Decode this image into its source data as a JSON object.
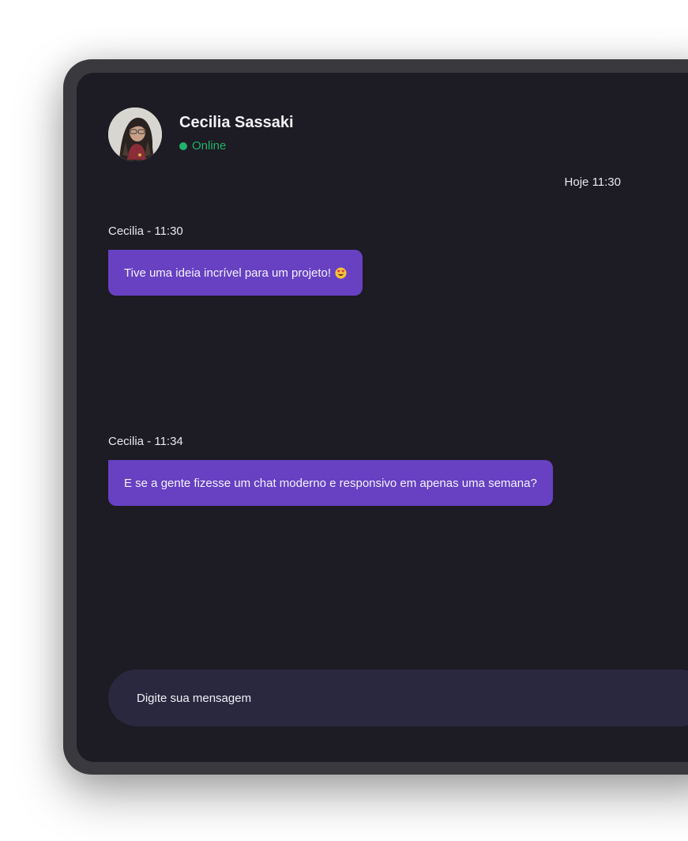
{
  "contact": {
    "name": "Cecilia Sassaki",
    "status": "Online",
    "avatar_icon": "user-avatar-photo"
  },
  "chat": {
    "date_separator": "Hoje 11:30",
    "messages": [
      {
        "meta": "Cecilia - 11:30",
        "text": "Tive uma ideia incrível para um projeto!",
        "emoji": "heart-eyes-emoji"
      },
      {
        "meta": "Cecilia - 11:34",
        "text": "E se a gente fizesse um chat moderno e responsivo em apenas uma semana?"
      }
    ]
  },
  "composer": {
    "placeholder": "Digite sua mensagem",
    "value": ""
  },
  "colors": {
    "background": "#1d1b23",
    "bubble": "#6741c2",
    "online": "#20b36a",
    "composer": "#29283f"
  }
}
